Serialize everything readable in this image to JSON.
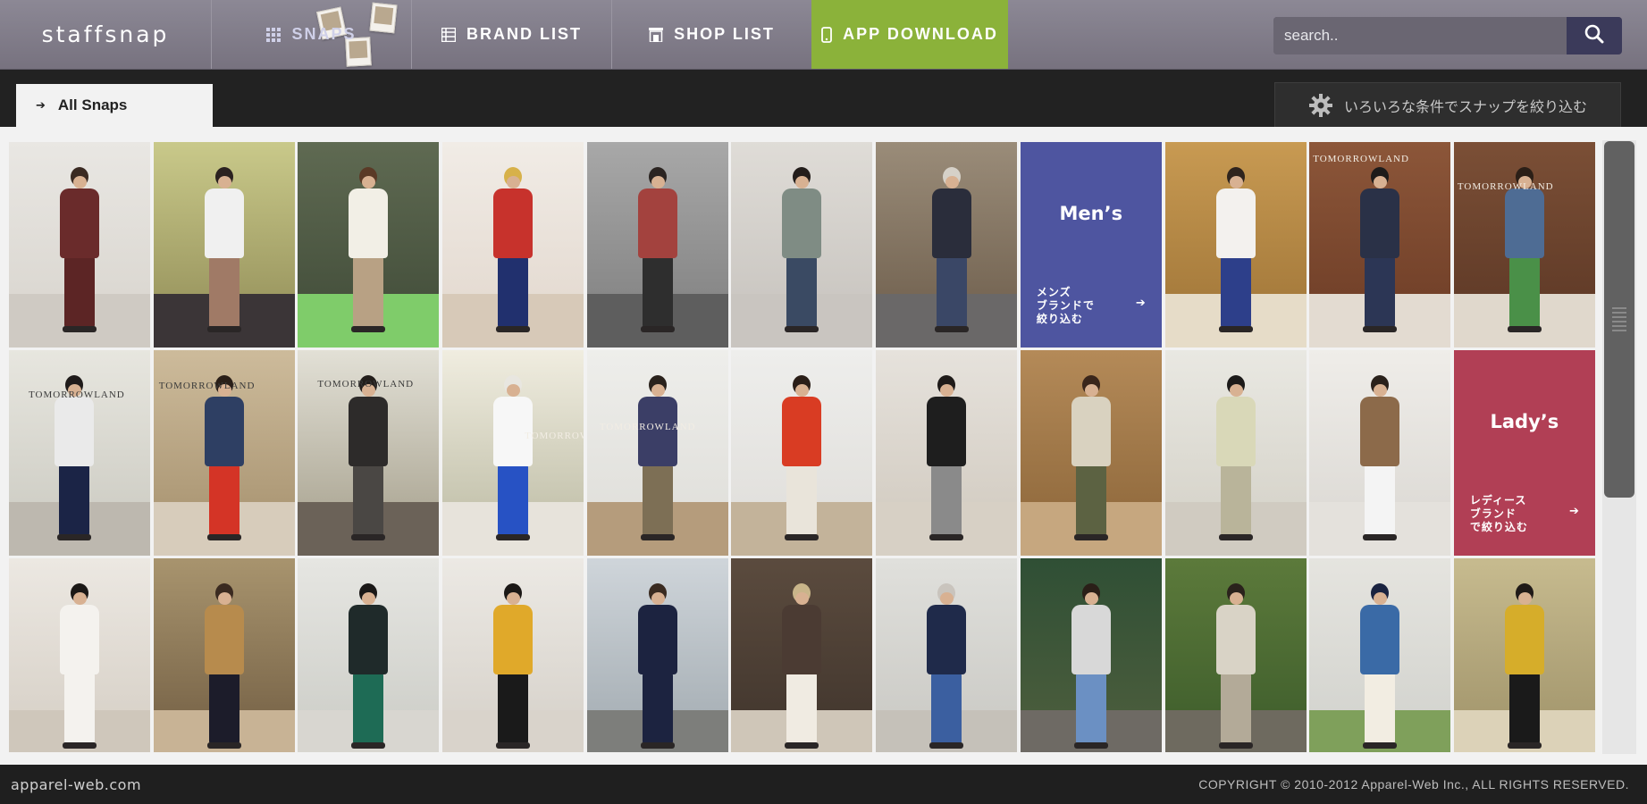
{
  "header": {
    "logo": "staffsnap",
    "nav": [
      {
        "label": "SNAPS",
        "icon": "grid-icon"
      },
      {
        "label": "BRAND LIST",
        "icon": "list-icon"
      },
      {
        "label": "SHOP LIST",
        "icon": "shop-icon"
      },
      {
        "label": "APP DOWNLOAD",
        "icon": "phone-icon"
      }
    ],
    "search": {
      "placeholder": "search..",
      "button_icon": "search-icon"
    }
  },
  "subbar": {
    "tab_all": "All Snaps",
    "filter_label": "いろいろな条件でスナップを絞り込む",
    "filter_icon": "gear-icon"
  },
  "grid": {
    "mens": {
      "title": "Men’s",
      "sub": "メンズ\nブランドで\n絞り込む"
    },
    "ladys": {
      "title": "Lady’s",
      "sub": "レディース\nブランド\nで絞り込む"
    },
    "tile_texts": {
      "tomorrowland": "TOMORROWLAND"
    }
  },
  "footer": {
    "logo": "apparel-web.com",
    "copyright": "COPYRIGHT © 2010-2012 Apparel-Web Inc., ALL RIGHTS RESERVED."
  },
  "colors": {
    "nav_bg": "#7f7a88",
    "app_download_bg": "#8bb23a",
    "subbar_bg": "#222222",
    "mens_bg": "#4e55a0",
    "ladys_bg": "#b13f55",
    "search_btn_bg": "#3b3a5a"
  }
}
